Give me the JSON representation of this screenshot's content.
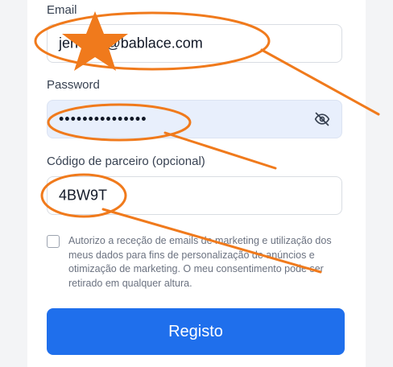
{
  "form": {
    "email_label": "Email",
    "email_value": "jen    83@bablace.com",
    "password_label": "Password",
    "password_value": "•••••••••••••••",
    "password_toggle_icon": "eye-off-icon",
    "partner_label": "Código de parceiro (opcional)",
    "partner_value": "4BW9T",
    "consent_text": "Autorizo a receção de emails de marketing e utilização dos meus dados para fins de personalização de anúncios e otimização de marketing. O meu consentimento pode ser retirado em qualquer altura.",
    "consent_checked": false,
    "submit_label": "Registo"
  },
  "colors": {
    "primary": "#1f6fec",
    "annotation": "#f07a1c",
    "filled_field": "#e8effc"
  }
}
